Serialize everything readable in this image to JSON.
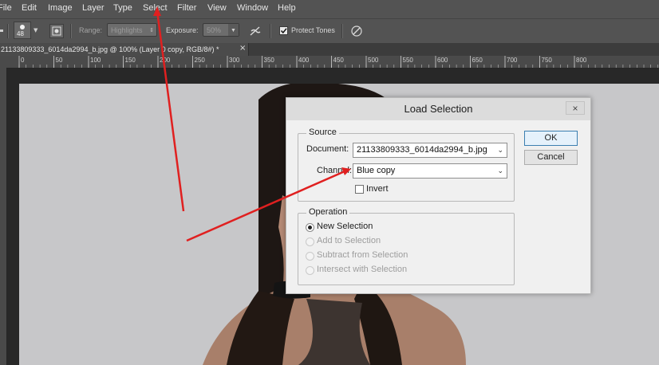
{
  "menu": [
    "File",
    "Edit",
    "Image",
    "Layer",
    "Type",
    "Select",
    "Filter",
    "View",
    "Window",
    "Help"
  ],
  "options": {
    "brush_size": "48",
    "range_label": "Range:",
    "range_value": "Highlights",
    "exposure_label": "Exposure:",
    "exposure_value": "50%",
    "protect_tones_label": "Protect Tones"
  },
  "document_tab": "21133809333_6014da2994_b.jpg @ 100% (Layer 0 copy, RGB/8#) *",
  "ruler_ticks": [
    "0",
    "50",
    "100",
    "150",
    "200",
    "250",
    "300",
    "350",
    "400",
    "450",
    "500",
    "550",
    "600",
    "650",
    "700",
    "750",
    "800"
  ],
  "dialog": {
    "title": "Load Selection",
    "close": "×",
    "source_legend": "Source",
    "document_label": "Document:",
    "document_value": "21133809333_6014da2994_b.jpg",
    "channel_label": "Channel:",
    "channel_value": "Blue copy",
    "invert_label": "Invert",
    "operation_legend": "Operation",
    "operations": [
      {
        "label": "New Selection",
        "selected": true,
        "enabled": true
      },
      {
        "label": "Add to Selection",
        "selected": false,
        "enabled": false
      },
      {
        "label": "Subtract from Selection",
        "selected": false,
        "enabled": false
      },
      {
        "label": "Intersect with Selection",
        "selected": false,
        "enabled": false
      }
    ],
    "ok_label": "OK",
    "cancel_label": "Cancel"
  },
  "colors": {
    "chrome": "#535353",
    "annotation_arrow": "#e02020",
    "default_button_border": "#3c7fb1"
  }
}
